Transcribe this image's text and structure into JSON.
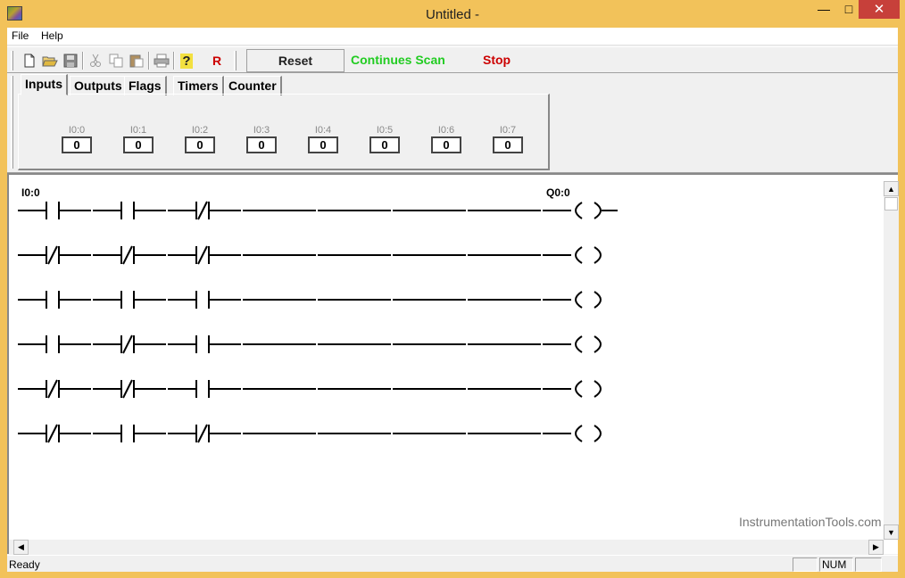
{
  "window": {
    "title": "Untitled -"
  },
  "menu": {
    "file": "File",
    "help": "Help"
  },
  "toolbar": {
    "buttons": [
      "new-icon",
      "open-icon",
      "save-icon",
      "cut-icon",
      "copy-icon",
      "paste-icon",
      "print-icon",
      "help-icon",
      "R"
    ],
    "r_label": "R",
    "help_label": "?"
  },
  "controls": {
    "reset": "Reset",
    "scan": "Continues Scan",
    "stop": "Stop"
  },
  "tabs": [
    "Inputs",
    "Outputs",
    "Flags",
    "Timers",
    "Counter"
  ],
  "active_tab": "Inputs",
  "inputs": [
    {
      "label": "I0:0",
      "value": "0"
    },
    {
      "label": "I0:1",
      "value": "0"
    },
    {
      "label": "I0:2",
      "value": "0"
    },
    {
      "label": "I0:3",
      "value": "0"
    },
    {
      "label": "I0:4",
      "value": "0"
    },
    {
      "label": "I0:5",
      "value": "0"
    },
    {
      "label": "I0:6",
      "value": "0"
    },
    {
      "label": "I0:7",
      "value": "0"
    }
  ],
  "ladder": {
    "first_contact_label": "I0:0",
    "first_coil_label": "Q0:0",
    "rungs": [
      {
        "contacts": [
          "NO",
          "NO",
          "NC"
        ],
        "coil": "coil"
      },
      {
        "contacts": [
          "NC",
          "NC",
          "NC"
        ],
        "coil": "coil"
      },
      {
        "contacts": [
          "NO",
          "NO",
          "NO"
        ],
        "coil": "coil"
      },
      {
        "contacts": [
          "NO",
          "NC",
          "NO"
        ],
        "coil": "coil"
      },
      {
        "contacts": [
          "NC",
          "NC",
          "NO"
        ],
        "coil": "coil"
      },
      {
        "contacts": [
          "NC",
          "NO",
          "NC"
        ],
        "coil": "coil"
      }
    ]
  },
  "watermark": "InstrumentationTools.com",
  "status": {
    "text": "Ready",
    "num": "NUM"
  }
}
